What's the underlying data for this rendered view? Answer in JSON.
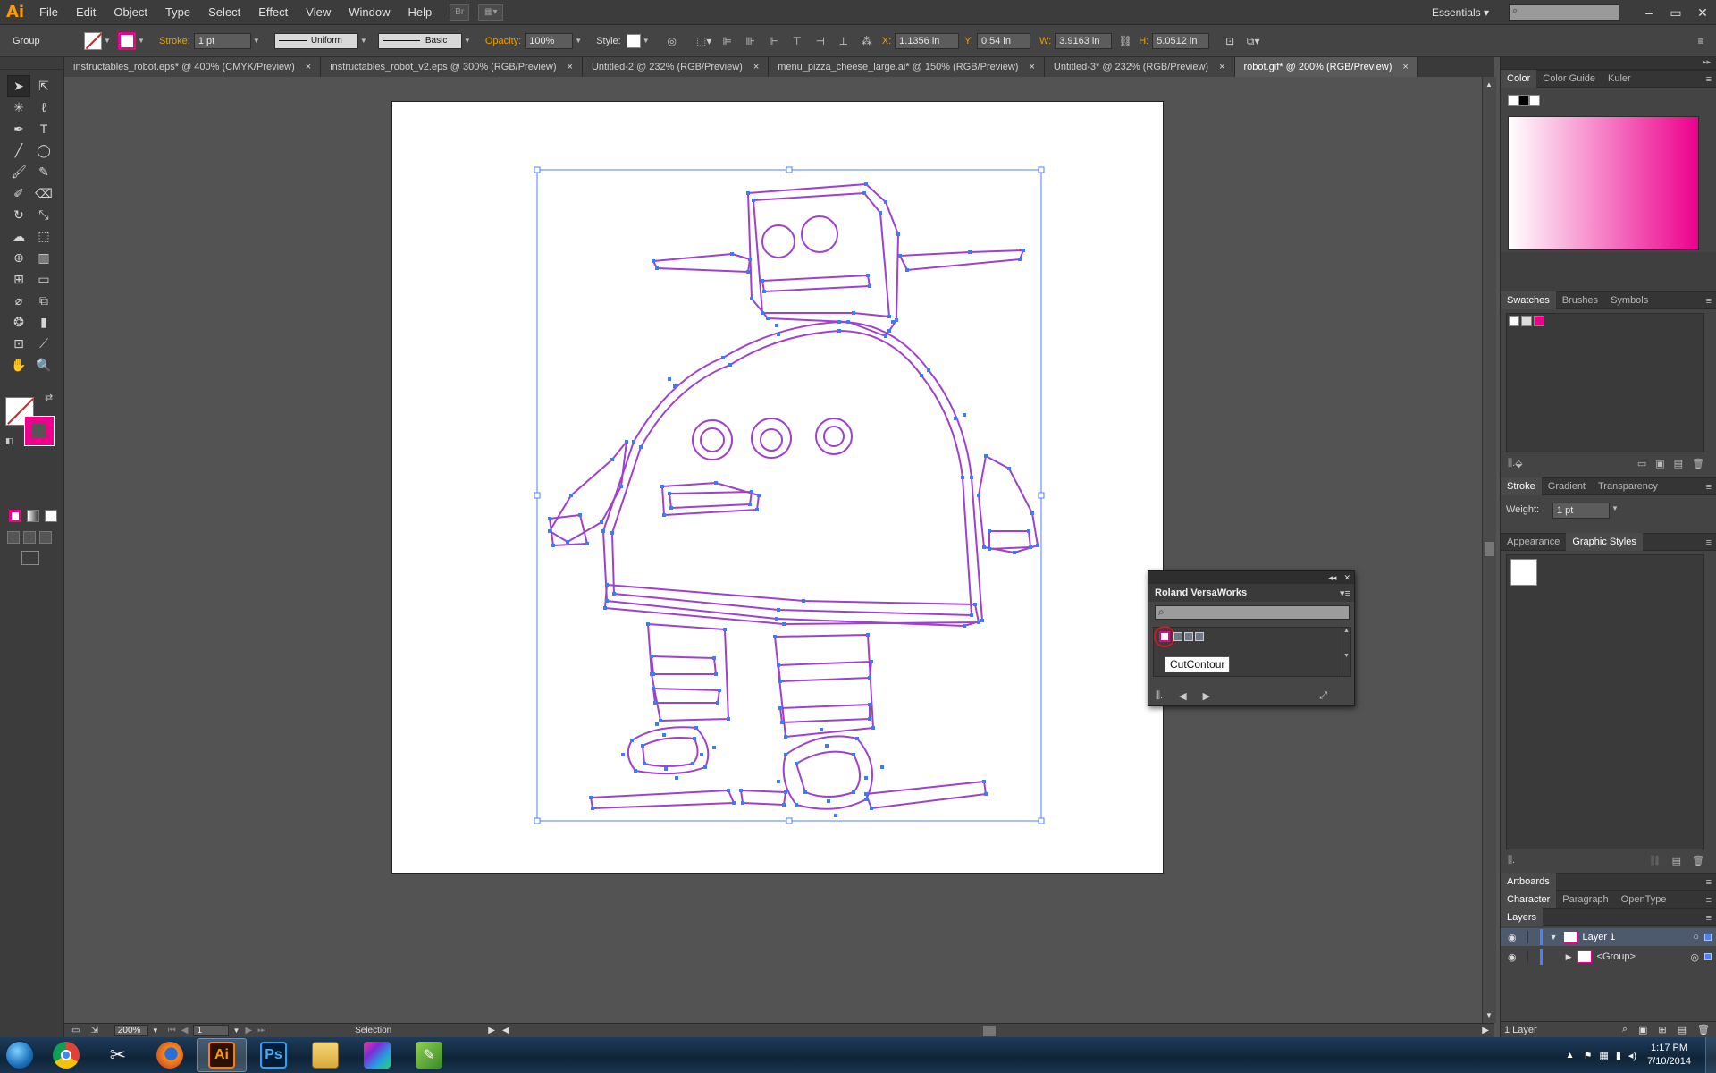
{
  "app": {
    "logo": "Ai",
    "menus": [
      "File",
      "Edit",
      "Object",
      "Type",
      "Select",
      "Effect",
      "View",
      "Window",
      "Help"
    ],
    "bridge_label": "Br",
    "workspace": "Essentials",
    "window_controls": [
      "–",
      "▭",
      "✕"
    ]
  },
  "control_bar": {
    "selection_type": "Group",
    "stroke_label": "Stroke:",
    "stroke_weight": "1 pt",
    "profile": "Uniform",
    "brush": "Basic",
    "opacity_label": "Opacity:",
    "opacity": "100%",
    "style_label": "Style:",
    "x_label": "X:",
    "x_value": "1.1356 in",
    "y_label": "Y:",
    "y_value": "0.54 in",
    "w_label": "W:",
    "w_value": "3.9163 in",
    "h_label": "H:",
    "h_value": "5.0512 in"
  },
  "tabs": [
    {
      "label": "instructables_robot.eps* @ 400% (CMYK/Preview)",
      "active": false
    },
    {
      "label": "instructables_robot_v2.eps @ 300% (RGB/Preview)",
      "active": false
    },
    {
      "label": "Untitled-2 @ 232% (RGB/Preview)",
      "active": false
    },
    {
      "label": "menu_pizza_cheese_large.ai* @ 150% (RGB/Preview)",
      "active": false
    },
    {
      "label": "Untitled-3* @ 232% (RGB/Preview)",
      "active": false
    },
    {
      "label": "robot.gif* @ 200% (RGB/Preview)",
      "active": true
    }
  ],
  "tab_close": "×",
  "status_bar": {
    "zoom": "200%",
    "artboard": "1",
    "tool": "Selection"
  },
  "roland_panel": {
    "title": "Roland VersaWorks",
    "tooltip": "CutContour"
  },
  "panels": {
    "color": {
      "tabs": [
        "Color",
        "Color Guide",
        "Kuler"
      ],
      "active": 0
    },
    "swatches": {
      "tabs": [
        "Swatches",
        "Brushes",
        "Symbols"
      ],
      "active": 0
    },
    "stroke": {
      "tabs": [
        "Stroke",
        "Gradient",
        "Transparency"
      ],
      "active": 0,
      "weight_label": "Weight:",
      "weight": "1 pt"
    },
    "appearance": {
      "tabs": [
        "Appearance",
        "Graphic Styles"
      ],
      "active": 1
    },
    "artboards": {
      "tabs": [
        "Artboards"
      ],
      "active": 0
    },
    "character": {
      "tabs": [
        "Character",
        "Paragraph",
        "OpenType"
      ],
      "active": 0
    },
    "layers": {
      "tabs": [
        "Layers"
      ],
      "active": 0,
      "rows": [
        {
          "name": "Layer 1"
        },
        {
          "name": "<Group>"
        }
      ],
      "footer": "1 Layer"
    }
  },
  "taskbar": {
    "time": "1:17 PM",
    "date": "7/10/2014",
    "apps": [
      {
        "name": "chrome",
        "label": ""
      },
      {
        "name": "snipping-tool",
        "label": ""
      },
      {
        "name": "firefox",
        "label": ""
      },
      {
        "name": "illustrator",
        "label": "Ai"
      },
      {
        "name": "photoshop",
        "label": "Ps"
      },
      {
        "name": "file-explorer",
        "label": ""
      },
      {
        "name": "app-7",
        "label": ""
      },
      {
        "name": "app-8",
        "label": ""
      }
    ]
  },
  "colors": {
    "magenta": "#ec008c",
    "path_purple": "#a040d0",
    "anchor_blue": "#3b7bff",
    "ai_orange": "#ff9a00"
  }
}
